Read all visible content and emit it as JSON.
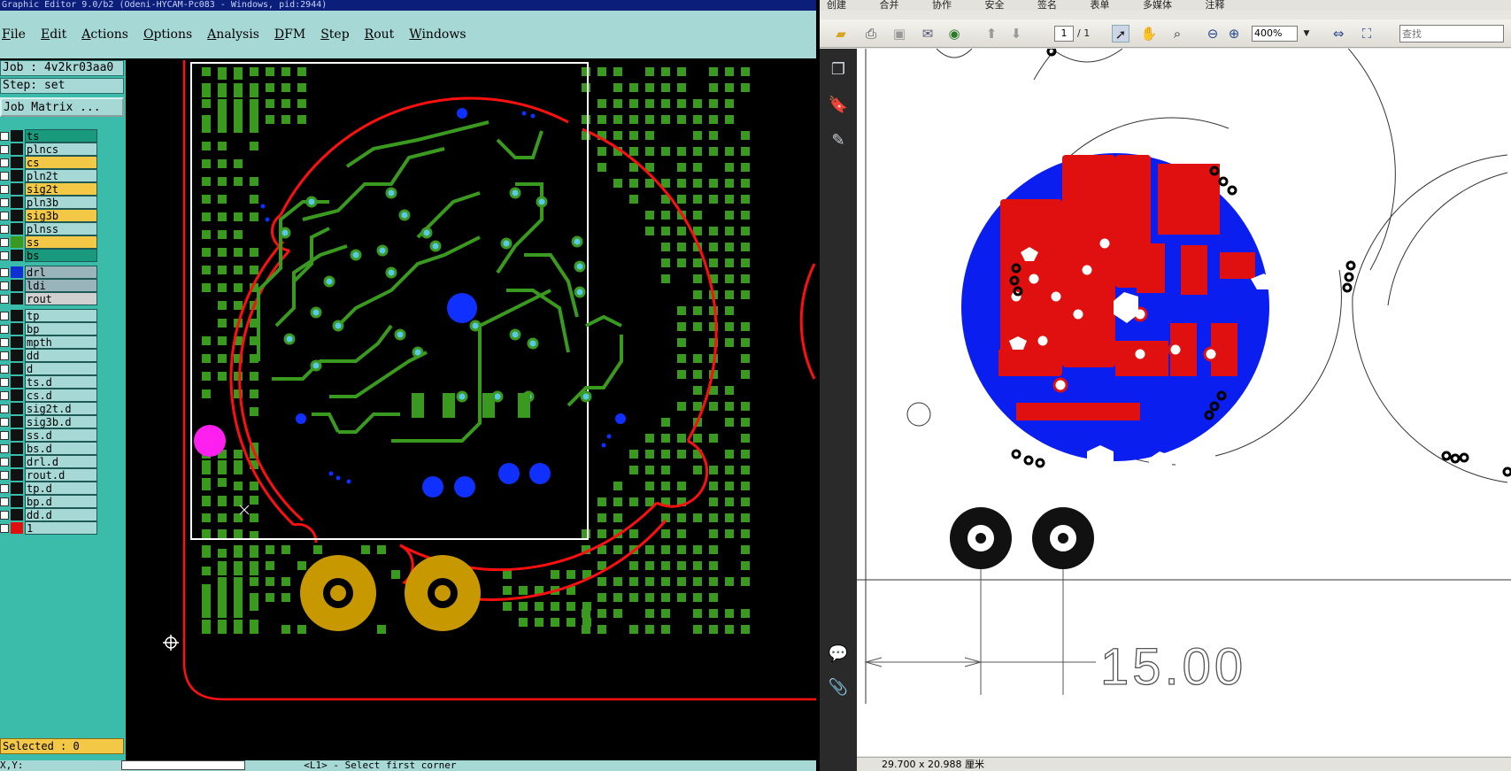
{
  "graphic_editor": {
    "title": "Graphic Editor 9.0/b2 (Odeni-HYCAM-Pc083 - Windows, pid:2944)",
    "menu": [
      "File",
      "Edit",
      "Actions",
      "Options",
      "Analysis",
      "DFM",
      "Step",
      "Rout",
      "Windows"
    ],
    "job_label": "Job : 4v2kr03aa0",
    "step_label": "Step: set",
    "job_matrix_button": "Job Matrix ...",
    "layers": [
      {
        "name": "ts",
        "color": "#1a9a7c",
        "swatch": "#111"
      },
      {
        "name": "plncs",
        "color": "#a6d8d6",
        "swatch": "#111"
      },
      {
        "name": "cs",
        "color": "#f2c846",
        "swatch": "#111"
      },
      {
        "name": "pln2t",
        "color": "#a6d8d6",
        "swatch": "#111"
      },
      {
        "name": "sig2t",
        "color": "#f2c846",
        "swatch": "#111"
      },
      {
        "name": "pln3b",
        "color": "#a6d8d6",
        "swatch": "#111"
      },
      {
        "name": "sig3b",
        "color": "#f2c846",
        "swatch": "#111"
      },
      {
        "name": "plnss",
        "color": "#a6d8d6",
        "swatch": "#111"
      },
      {
        "name": "ss",
        "color": "#f2c846",
        "swatch": "#3a9a20"
      },
      {
        "name": "bs",
        "color": "#1a9a7c",
        "swatch": "#111"
      },
      {
        "name": "drl",
        "color": "#9ab4bc",
        "swatch": "#1030d0"
      },
      {
        "name": "ldi",
        "color": "#9ab4bc",
        "swatch": "#111"
      },
      {
        "name": "rout",
        "color": "#d0d0d0",
        "swatch": "#111"
      },
      {
        "name": "tp",
        "color": "#a6d8d6",
        "swatch": "#111"
      },
      {
        "name": "bp",
        "color": "#a6d8d6",
        "swatch": "#111"
      },
      {
        "name": "mpth",
        "color": "#a6d8d6",
        "swatch": "#111"
      },
      {
        "name": "dd",
        "color": "#a6d8d6",
        "swatch": "#111"
      },
      {
        "name": "d",
        "color": "#a6d8d6",
        "swatch": "#111"
      },
      {
        "name": "ts.d",
        "color": "#a6d8d6",
        "swatch": "#111"
      },
      {
        "name": "cs.d",
        "color": "#a6d8d6",
        "swatch": "#111"
      },
      {
        "name": "sig2t.d",
        "color": "#a6d8d6",
        "swatch": "#111"
      },
      {
        "name": "sig3b.d",
        "color": "#a6d8d6",
        "swatch": "#111"
      },
      {
        "name": "ss.d",
        "color": "#a6d8d6",
        "swatch": "#111"
      },
      {
        "name": "bs.d",
        "color": "#a6d8d6",
        "swatch": "#111"
      },
      {
        "name": "drl.d",
        "color": "#a6d8d6",
        "swatch": "#111"
      },
      {
        "name": "rout.d",
        "color": "#a6d8d6",
        "swatch": "#111"
      },
      {
        "name": "tp.d",
        "color": "#a6d8d6",
        "swatch": "#111"
      },
      {
        "name": "bp.d",
        "color": "#a6d8d6",
        "swatch": "#111"
      },
      {
        "name": "dd.d",
        "color": "#a6d8d6",
        "swatch": "#111"
      },
      {
        "name": "1",
        "color": "#a6d8d6",
        "swatch": "#e01010"
      }
    ],
    "selected_status": "Selected : 0",
    "bottom_prompt": "<L1> - Select first corner",
    "bottom_xy_label": "X,Y:"
  },
  "pdf_reader": {
    "top_toolbar": [
      "创建",
      "合并",
      "协作",
      "安全",
      "签名",
      "表单",
      "多媒体",
      "注释"
    ],
    "page_number": "1",
    "page_total": "/ 1",
    "zoom": "400%",
    "search_placeholder": "查找",
    "page_size": "29.700 x 20.988 厘米",
    "dimension_value": "15.00"
  }
}
